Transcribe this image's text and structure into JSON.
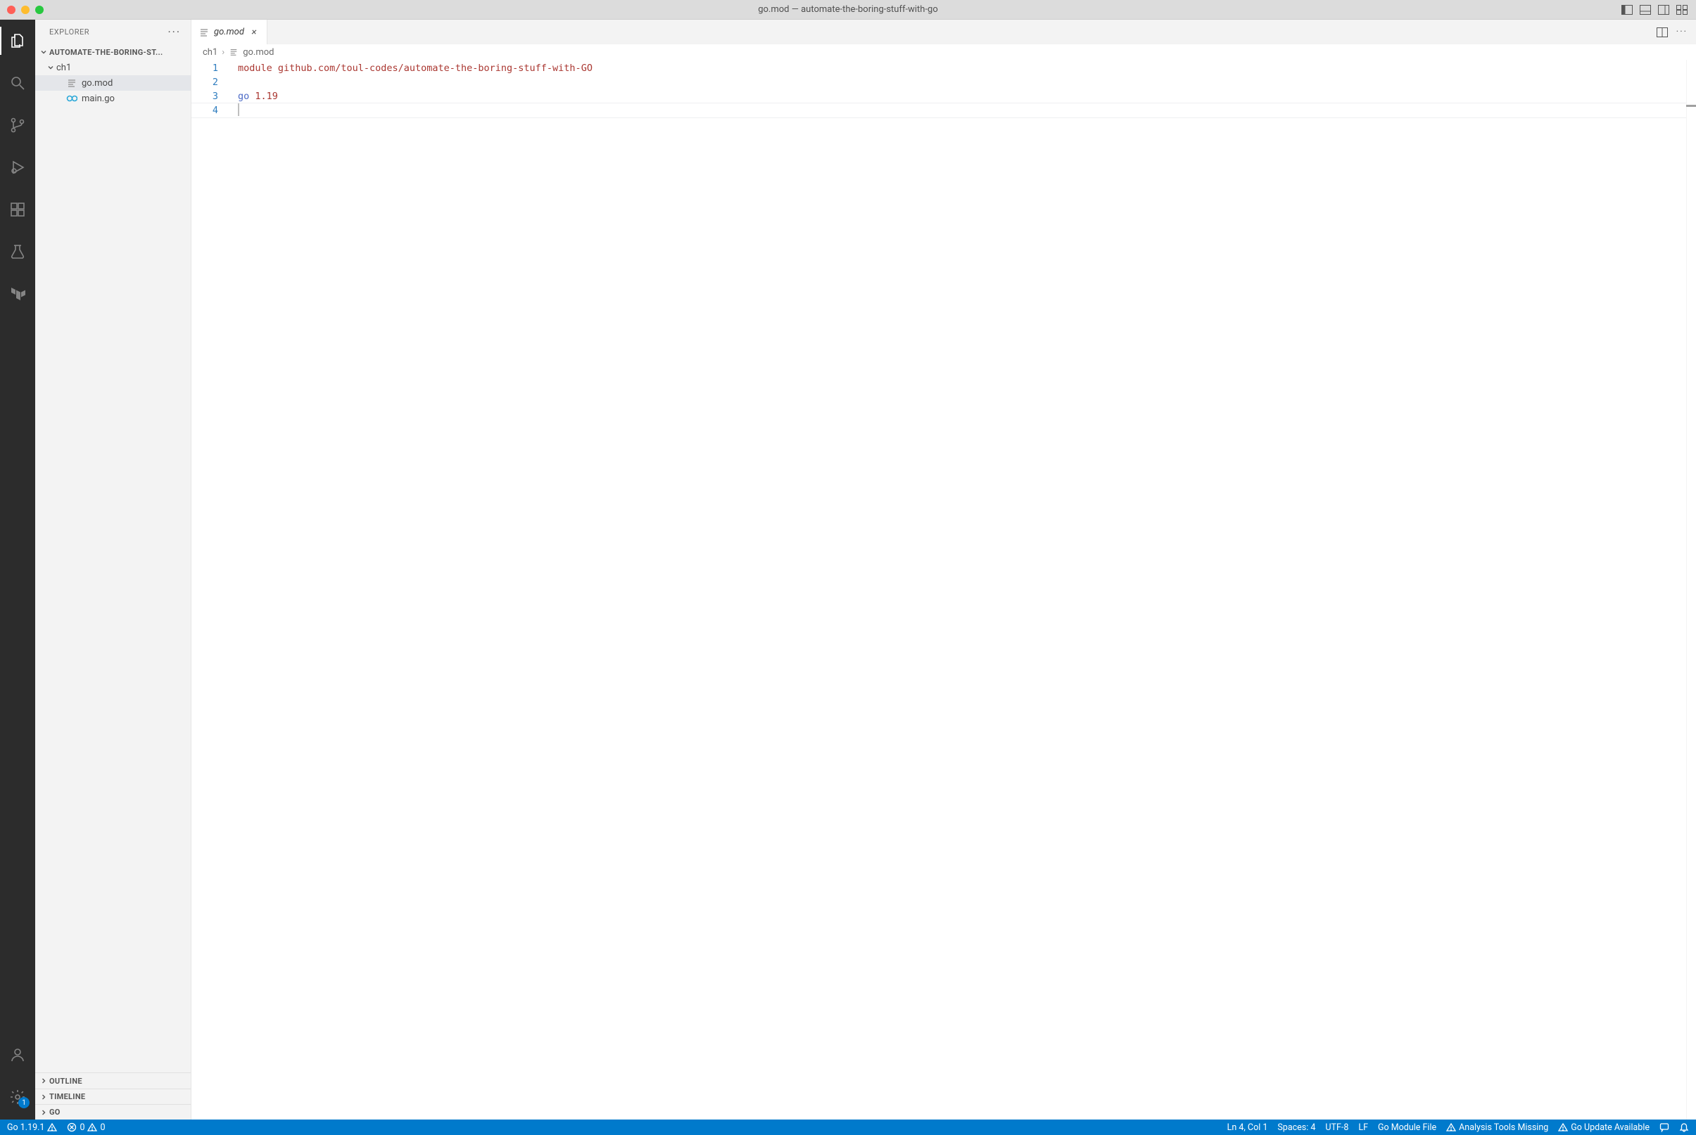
{
  "window": {
    "title": "go.mod — automate-the-boring-stuff-with-go"
  },
  "sidebar": {
    "title": "EXPLORER",
    "project": "AUTOMATE-THE-BORING-ST...",
    "tree": {
      "folder1": "ch1",
      "file1": "go.mod",
      "file2": "main.go"
    },
    "sections": {
      "outline": "OUTLINE",
      "timeline": "TIMELINE",
      "go": "GO"
    }
  },
  "tab": {
    "title": "go.mod"
  },
  "breadcrumbs": {
    "c0": "ch1",
    "c1": "go.mod"
  },
  "code": {
    "lines": {
      "l1": "1",
      "l2": "2",
      "l3": "3",
      "l4": "4"
    },
    "line1a": "module",
    "line1b": "github.com/toul-codes/automate-the-boring-stuff-with-GO",
    "line3a": "go",
    "line3b": "1.19"
  },
  "status": {
    "go_version": "Go 1.19.1",
    "errors": "0",
    "warnings": "0",
    "cursor": "Ln 4, Col 1",
    "spaces": "Spaces: 4",
    "encoding": "UTF-8",
    "eol": "LF",
    "lang": "Go Module File",
    "tools": "Analysis Tools Missing",
    "update": "Go Update Available",
    "settings_badge": "1"
  }
}
